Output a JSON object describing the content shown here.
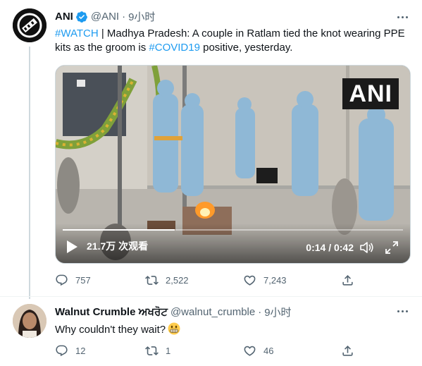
{
  "tweet": {
    "display_name": "ANI",
    "handle": "@ANI",
    "separator": "·",
    "time": "9小时",
    "text": {
      "hashtag1": "#WATCH",
      "part1": " | Madhya Pradesh: A couple in Ratlam tied the knot wearing PPE kits as the groom is ",
      "hashtag2": "#COVID19",
      "part2": " positive, yesterday."
    },
    "video": {
      "watermark": "ANI",
      "views": "21.7万 次观看",
      "time": "0:14 / 0:42",
      "progress": 0.33
    },
    "actions": {
      "replies": "757",
      "retweets": "2,522",
      "likes": "7,243"
    }
  },
  "reply": {
    "display_name": "Walnut Crumble ਅਖਰੋਟ",
    "handle": "@walnut_crumble",
    "separator": "·",
    "time": "9小时",
    "text": "Why couldn't they wait?",
    "emoji": "grimacing-face",
    "actions": {
      "replies": "12",
      "retweets": "1",
      "likes": "46"
    }
  },
  "colors": {
    "link": "#1d9bf0",
    "secondary_text": "#536471",
    "thread_line": "#cfd9de",
    "verified": "#1d9bf0"
  },
  "icons": {
    "avatar_main": "ani-logo-avatar",
    "verified": "verified-badge-icon",
    "more": "more-dots-icon",
    "reply": "reply-icon",
    "retweet": "retweet-icon",
    "like": "heart-icon",
    "share": "share-icon",
    "play": "play-icon",
    "volume": "volume-icon",
    "fullscreen": "fullscreen-icon"
  }
}
